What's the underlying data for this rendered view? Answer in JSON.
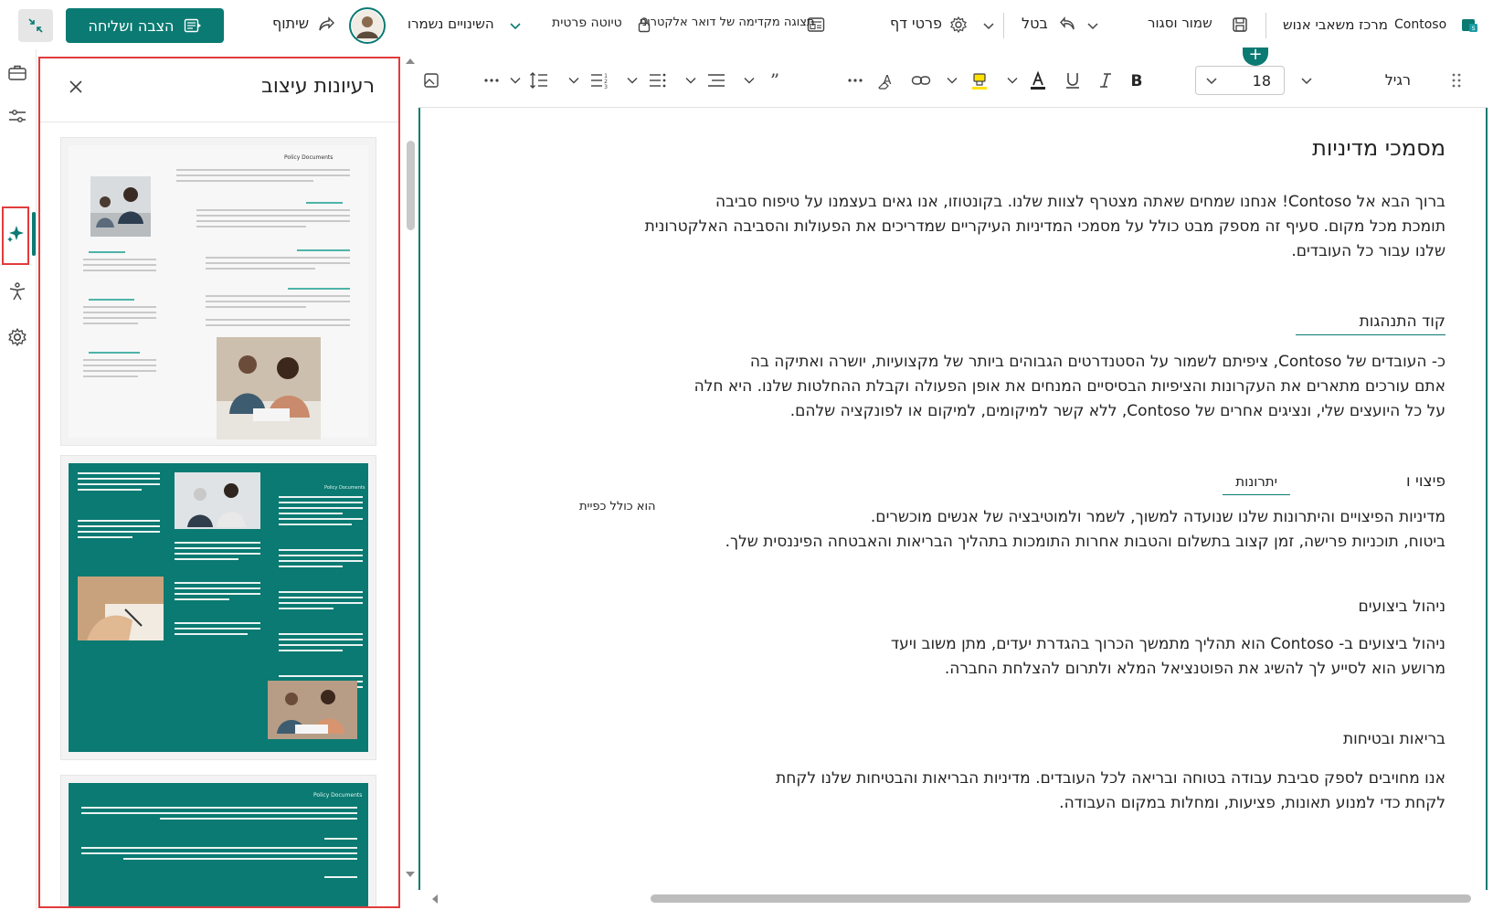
{
  "topbar": {
    "org": "Contoso",
    "site": "מרכז משאבי אנוש",
    "save_close": "שמור וסגור",
    "undo": "בטל",
    "page_details": "פרטי דף",
    "email_preview": "תצוגה מקדימה של דואר אלקטרוני",
    "private_draft": "טיוטה פרטית",
    "saved_status": "השינויים נשמרו",
    "share": "שיתוף",
    "publish": "הצבה ושליחה"
  },
  "pane": {
    "title": "רעיונות עיצוב",
    "thumb_heading": "Policy Documents"
  },
  "toolbar": {
    "style": "רגיל",
    "font_size": "18"
  },
  "doc": {
    "title": "מסמכי מדיניות",
    "intro_lines": [
      "ברוך הבא אל Contoso!   אנחנו שמחים שאתה מצטרף לצוות שלנו. בקונטוזו, אנו גאים בעצמנו על טיפוח סביבה",
      "תומכת מכל מקום. סעיף זה מספק מבט כולל על מסמכי המדיניות העיקריים שמדריכים את הפעולות והסביבה האלקטרונית",
      "שלנו עבור כל העובדים."
    ],
    "conduct_heading": "קוד התנהגות",
    "conduct_lines": [
      "כ-    העובדים של Contoso, ציפיתם לשמור על הסטנדרטים הגבוהים ביותר של מקצועיות, יושרה ואתיקה בה",
      "אתם עורכים מתארים את העקרונות והציפיות הבסיסיים המנחים את אופן הפעולה וקבלת ההחלטות שלנו. היא חלה",
      "על כל היועצים שלי, ונציגים אחרים של Contoso, ללא קשר למיקומים, למיקום או לפונקציה שלהם."
    ],
    "comp_heading_a": "פיצוי ו",
    "comp_heading_b": "יתרונות",
    "comp_side_note": "הוא כולל כפיית",
    "comp_lines": [
      "מדיניות הפיצויים והיתרונות שלנו שנועדה למשוך, לשמר ולמוטיבציה של אנשים מוכשרים.",
      "ביטוח, תוכניות פרישה, זמן קצוב בתשלום והטבות אחרות התומכות בתהליך הבריאות והאבטחה הפיננסית שלך."
    ],
    "perf_heading": "ניהול ביצועים",
    "perf_lines": [
      "ניהול ביצועים ב- Contoso הוא תהליך מתמשך הכרוך בהגדרת יעדים, מתן משוב ויעד",
      "מרושע הוא לסייע לך להשיג את הפוטנציאל המלא ולתרום להצלחת החברה."
    ],
    "health_heading": "בריאות ובטיחות",
    "health_lines": [
      "אנו מחויבים לספק סביבת עבודה בטוחה ובריאה לכל העובדים. מדיניות הבריאות והבטיחות שלנו לקחת",
      "לקחת כדי למנוע תאונות, פציעות, ומחלות במקום העבודה."
    ]
  },
  "colors": {
    "accent": "#0a7a72",
    "highlight_border": "#e23b3b"
  }
}
